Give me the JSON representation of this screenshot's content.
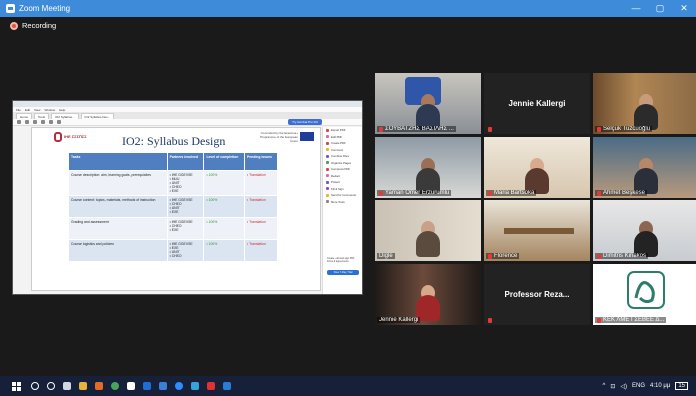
{
  "window": {
    "title": "Zoom Meeting",
    "min_label": "—",
    "max_label": "▢",
    "close_label": "✕"
  },
  "recording": {
    "label": "Recording"
  },
  "share": {
    "menu": [
      "File",
      "Edit",
      "View",
      "Window",
      "Help"
    ],
    "tabs": [
      "Home",
      "Tools",
      "IO2 Syllabus...",
      "IO2 Syllabus Des..."
    ],
    "toolbar_button": "Try Acrobat Pro DC",
    "doc": {
      "logo_text": "IHE ΣΣΣΠΣΣ",
      "title": "IO2: Syllabus Design",
      "eu_text": "Co-funded by the Erasmus+ Programme of the European Union",
      "headers": [
        "Tasks",
        "Partners involved",
        "Level of completion",
        "Pending issues"
      ],
      "rows": [
        {
          "task": "Course description: aim, learning goals, prerequisites",
          "partners": "• IHE GGEVSE\n• MUU\n• UNIT\n• CHEO\n• EXE",
          "level": "• 100%",
          "pending": "• Translation"
        },
        {
          "task": "Course content: topics, materials, methods of instruction",
          "partners": "• IHE GGEVSE\n• CHEO\n• UNIT\n• EXE",
          "level": "• 100%",
          "pending": "• Translation"
        },
        {
          "task": "Grading and assessment",
          "partners": "• IHE GGEVSE\n• CHEO\n• EXE",
          "level": "• 100%",
          "pending": "• Translation"
        },
        {
          "task": "Course logistics and policies",
          "partners": "• IHE GGEVSE\n• EXE\n• UNIT\n• CHEO",
          "level": "• 100%",
          "pending": "• Translation"
        }
      ]
    },
    "pane": {
      "items": [
        "Export PDF",
        "Edit PDF",
        "Create PDF",
        "Comment",
        "Combine Files",
        "Organize Pages",
        "Compress PDF",
        "Redact",
        "Protect",
        "Fill & Sign",
        "Send for Comments",
        "More Tools"
      ],
      "note": "Create, edit and sign PDF forms & agreements",
      "button": "Free 7-Day Trial"
    }
  },
  "participants": [
    {
      "name": "ΣΟΥΒΑΤΖΗΣ ΒΑΣΙΛΗΣ ...",
      "active": true
    },
    {
      "name": "Jennie Kallergi",
      "video": false
    },
    {
      "name": "Selçuk Tuzcuoğlu"
    },
    {
      "name": "Yaman Omer Erzurumlu"
    },
    {
      "name": "Maria Bartsoka"
    },
    {
      "name": "Ahmet Beşkese"
    },
    {
      "name": "Digle"
    },
    {
      "name": "Florence"
    },
    {
      "name": "Dimitris Kiriakos"
    },
    {
      "name": "Jennie Kallergi"
    },
    {
      "name": "Professor Reza...",
      "video": false
    },
    {
      "name": "ΚΕΚ ΛΜΕ ΓΣΕΒΕΕ Δ..."
    }
  ],
  "taskbar": {
    "lang": "ENG",
    "time": "4:10 μμ",
    "notif": "15"
  },
  "colors": {
    "zoom_blue": "#3d8bd9",
    "active_speaker": "#c7e14a",
    "mic_off": "#e03a3a"
  }
}
